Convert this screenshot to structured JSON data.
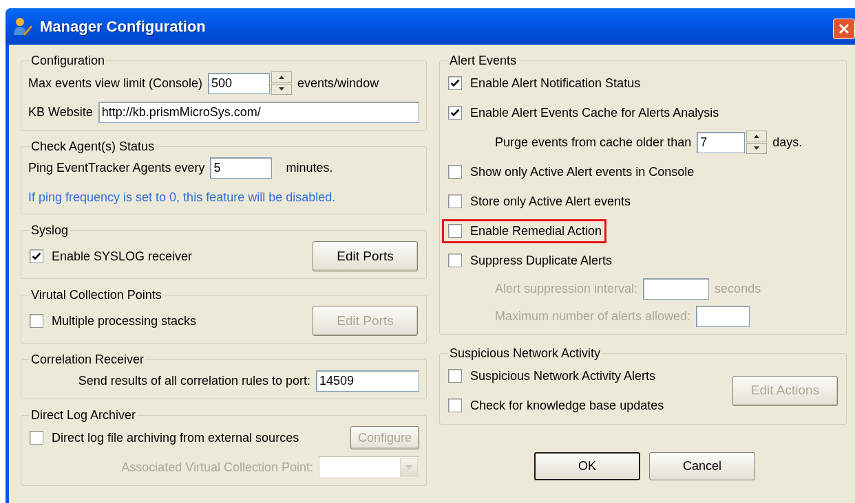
{
  "window": {
    "title": "Manager Configuration"
  },
  "left_groups": [
    {
      "title": "Configuration",
      "rows": [
        {
          "kind": "spin_field",
          "label": "Max events view limit (Console)",
          "value": "500",
          "suffix": "events/window"
        },
        {
          "kind": "text_field",
          "label": "KB Website",
          "value": "http://kb.prismMicroSys.com/"
        }
      ]
    },
    {
      "title": "Check Agent(s) Status",
      "rows": [
        {
          "kind": "text_field",
          "label": "Ping EventTracker Agents every",
          "value": "5",
          "suffix": "minutes."
        },
        {
          "kind": "note",
          "text": "If ping frequency is set to 0, this feature will be disabled."
        }
      ]
    },
    {
      "title": "Syslog",
      "rows": [
        {
          "kind": "checkbox",
          "label": "Enable SYSLOG receiver",
          "checked": true
        }
      ],
      "button": {
        "label": "Edit Ports",
        "disabled": false
      }
    },
    {
      "title": "Virutal Collection Points",
      "rows": [
        {
          "kind": "checkbox",
          "label": "Multiple processing stacks",
          "checked": false
        }
      ],
      "button": {
        "label": "Edit Ports",
        "disabled": true
      }
    },
    {
      "title": "Correlation Receiver",
      "rows": [
        {
          "kind": "port_field",
          "label": "Send results of all correlation rules to port:",
          "value": "14509"
        }
      ]
    },
    {
      "title": "Direct Log Archiver",
      "rows": [
        {
          "kind": "checkbox",
          "label": "Direct log file archiving from external sources",
          "checked": false,
          "button": {
            "label": "Configure",
            "disabled": true
          }
        },
        {
          "kind": "combo",
          "label": "Associated Virtual Collection Point:",
          "disabled": true
        }
      ]
    }
  ],
  "right_groups": [
    {
      "title": "Alert Events",
      "rows": [
        {
          "kind": "checkbox",
          "label": "Enable Alert Notification Status",
          "checked": true
        },
        {
          "kind": "checkbox",
          "label": "Enable Alert Events Cache for Alerts Analysis",
          "checked": true
        },
        {
          "kind": "spin_field",
          "label": "Purge events from cache older than",
          "value": "7",
          "suffix": "days.",
          "nested": true
        },
        {
          "kind": "checkbox",
          "label": "Show only Active Alert events in Console",
          "checked": false
        },
        {
          "kind": "checkbox",
          "label": "Store only Active Alert events",
          "checked": false
        },
        {
          "kind": "checkbox",
          "label": "Enable Remedial Action",
          "checked": false,
          "highlighted": true
        },
        {
          "kind": "checkbox",
          "label": "Suppress Duplicate Alerts",
          "checked": false
        },
        {
          "kind": "text_field",
          "label": "Alert suppression interval:",
          "suffix": "seconds",
          "nested": true,
          "disabled": true
        },
        {
          "kind": "text_field",
          "label": "Maximum number of alerts allowed:",
          "nested": true,
          "disabled": true
        }
      ]
    },
    {
      "title": "Suspicious Network Activity",
      "rows": [
        {
          "kind": "checkbox",
          "label": "Suspicious Network Activity Alerts",
          "checked": false
        },
        {
          "kind": "checkbox",
          "label": "Check for knowledge base updates",
          "checked": false
        }
      ],
      "button": {
        "label": "Edit Actions",
        "disabled": true
      }
    }
  ],
  "buttons": [
    {
      "label": "OK",
      "default": true
    },
    {
      "label": "Cancel",
      "default": false
    }
  ]
}
